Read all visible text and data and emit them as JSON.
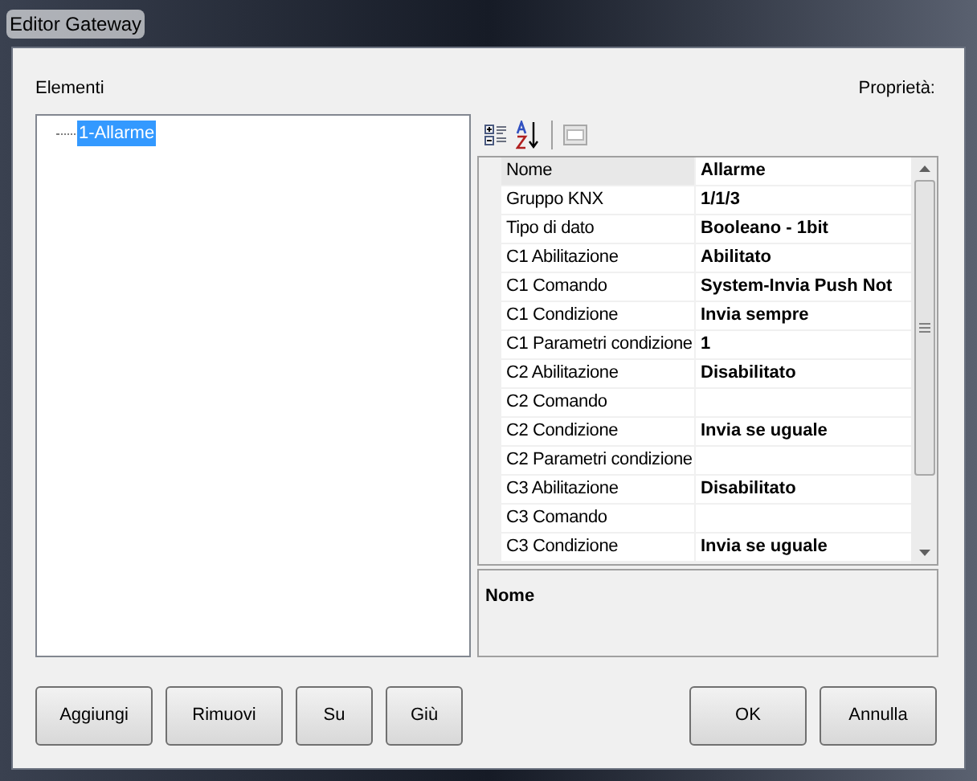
{
  "window": {
    "title": "Editor Gateway"
  },
  "elements_label": "Elementi",
  "properties_label": "Proprietà:",
  "tree": {
    "items": [
      {
        "label": "1-Allarme",
        "selected": true
      }
    ]
  },
  "properties": {
    "rows": [
      {
        "name": "Nome",
        "value": "Allarme",
        "selected": true
      },
      {
        "name": "Gruppo KNX",
        "value": "1/1/3",
        "selected": false
      },
      {
        "name": "Tipo di dato",
        "value": "Booleano - 1bit",
        "selected": false
      },
      {
        "name": "C1 Abilitazione",
        "value": "Abilitato",
        "selected": false
      },
      {
        "name": "C1 Comando",
        "value": "System-Invia Push Not",
        "selected": false
      },
      {
        "name": "C1 Condizione",
        "value": "Invia sempre",
        "selected": false
      },
      {
        "name": "C1 Parametri condizione",
        "value": "1",
        "selected": false
      },
      {
        "name": "C2 Abilitazione",
        "value": "Disabilitato",
        "selected": false
      },
      {
        "name": "C2 Comando",
        "value": "",
        "selected": false
      },
      {
        "name": "C2 Condizione",
        "value": "Invia se uguale",
        "selected": false
      },
      {
        "name": "C2 Parametri condizione",
        "value": "",
        "selected": false
      },
      {
        "name": "C3 Abilitazione",
        "value": "Disabilitato",
        "selected": false
      },
      {
        "name": "C3 Comando",
        "value": "",
        "selected": false
      },
      {
        "name": "C3 Condizione",
        "value": "Invia se uguale",
        "selected": false
      }
    ]
  },
  "help": {
    "title": "Nome"
  },
  "left_buttons": [
    "Aggiungi",
    "Rimuovi",
    "Su",
    "Giù"
  ],
  "right_buttons": [
    "OK",
    "Annulla"
  ]
}
